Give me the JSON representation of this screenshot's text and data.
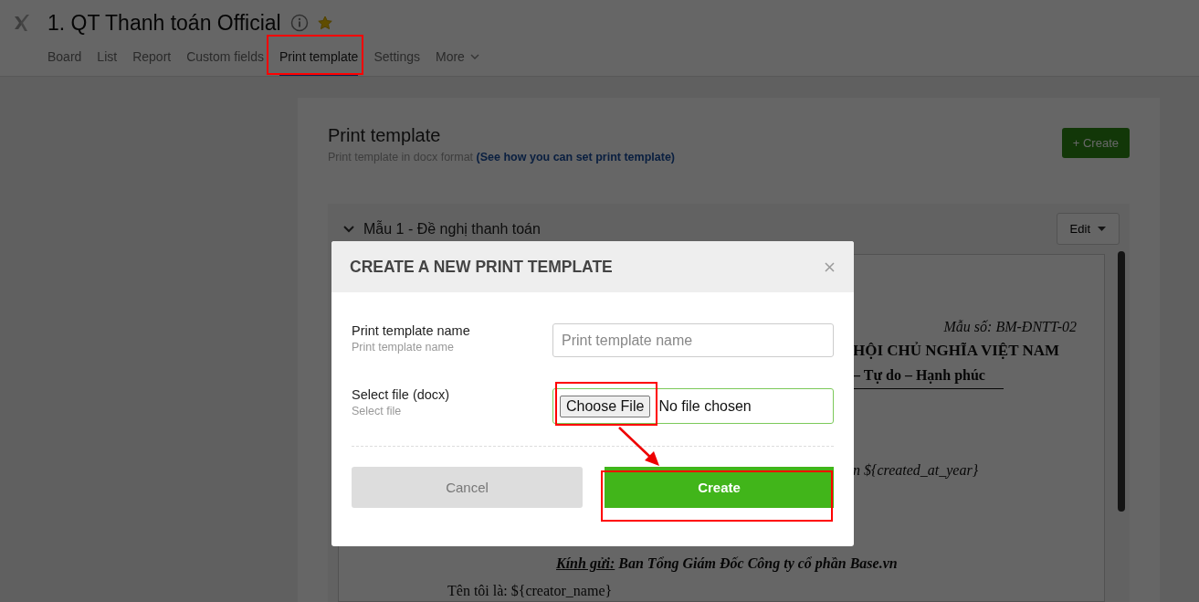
{
  "header": {
    "title": "1. QT Thanh toán Official",
    "starred": true,
    "tabs": [
      {
        "label": "Board",
        "selected": false
      },
      {
        "label": "List",
        "selected": false
      },
      {
        "label": "Report",
        "selected": false
      },
      {
        "label": "Custom fields",
        "selected": false
      },
      {
        "label": "Print template",
        "selected": true
      },
      {
        "label": "Settings",
        "selected": false
      },
      {
        "label": "More",
        "selected": false,
        "kind": "dropdown"
      }
    ]
  },
  "panel": {
    "title": "Print template",
    "subtitle": "Print template in docx format",
    "help_link": "(See how you can set print template)",
    "create_button": "+ Create",
    "template": {
      "name": "Mẫu 1 - Đề nghị thanh toán",
      "expanded": true,
      "edit_button": "Edit",
      "document": [
        {
          "kind": "form_no",
          "text": "Mẫu số: BM-ĐNTT-02"
        },
        {
          "kind": "heading",
          "text": "HỘI CHỦ NGHĨA VIỆT NAM"
        },
        {
          "kind": "motto",
          "text": "– Tự do – Hạnh phúc"
        },
        {
          "kind": "date",
          "text": "n ${created_at_year}"
        },
        {
          "kind": "addressee",
          "label": "Kính gửi:",
          "text": "Ban Tổng Giám Đốc Công ty cổ phần Base.vn"
        },
        {
          "kind": "body",
          "text": "Tên tôi là: ${creator_name}"
        }
      ]
    }
  },
  "dialog": {
    "title": "CREATE A NEW PRINT TEMPLATE",
    "fields": [
      {
        "kind": "text",
        "label": "Print template name",
        "hint": "Print template name",
        "placeholder": "Print template name"
      },
      {
        "kind": "file",
        "label": "Select file (docx)",
        "hint": "Select file",
        "button": "Choose File",
        "status": "No file chosen"
      }
    ],
    "cancel": "Cancel",
    "submit": "Create"
  }
}
